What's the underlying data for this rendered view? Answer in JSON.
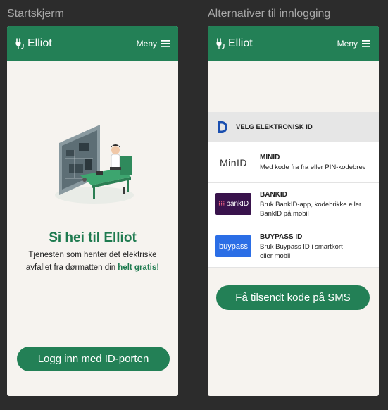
{
  "screens": [
    {
      "label": "Startskjerm",
      "app_name": "Elliot",
      "menu_label": "Meny",
      "greeting": "Si hei til Elliot",
      "description_line1": "Tjenesten som henter det elektriske",
      "description_line2_prefix": "avfallet fra dørmatten din ",
      "description_link": "helt gratis!",
      "login_button": "Logg inn med ID-porten"
    },
    {
      "label": "Alternativer til innlogging",
      "app_name": "Elliot",
      "menu_label": "Meny",
      "section_heading": "VELG ELEKTRONISK ID",
      "options": [
        {
          "logo_text": "MinID",
          "title": "MINID",
          "desc_line1": "Med kode fra fra eller PIN-kodebrev",
          "desc_line2": ""
        },
        {
          "logo_text": "bankID",
          "title": "BANKID",
          "desc_line1": "Bruk BankID-app, kodebrikke eller",
          "desc_line2": "BankID på mobil"
        },
        {
          "logo_text": "buypass",
          "title": "BUYPASS ID",
          "desc_line1": "Bruk Buypass ID i smartkort",
          "desc_line2": "eller mobil"
        }
      ],
      "sms_button": "Få tilsendt kode på SMS"
    }
  ],
  "colors": {
    "brand_green": "#238056",
    "background_dark": "#2c2c2c",
    "screen_bg": "#f6f3ef",
    "bankid_bg": "#39134c",
    "buypass_bg": "#2b6ee6",
    "minid_red": "#c8102e"
  },
  "icons": [
    "plug-icon",
    "hamburger-menu-icon",
    "eid-d-icon"
  ]
}
